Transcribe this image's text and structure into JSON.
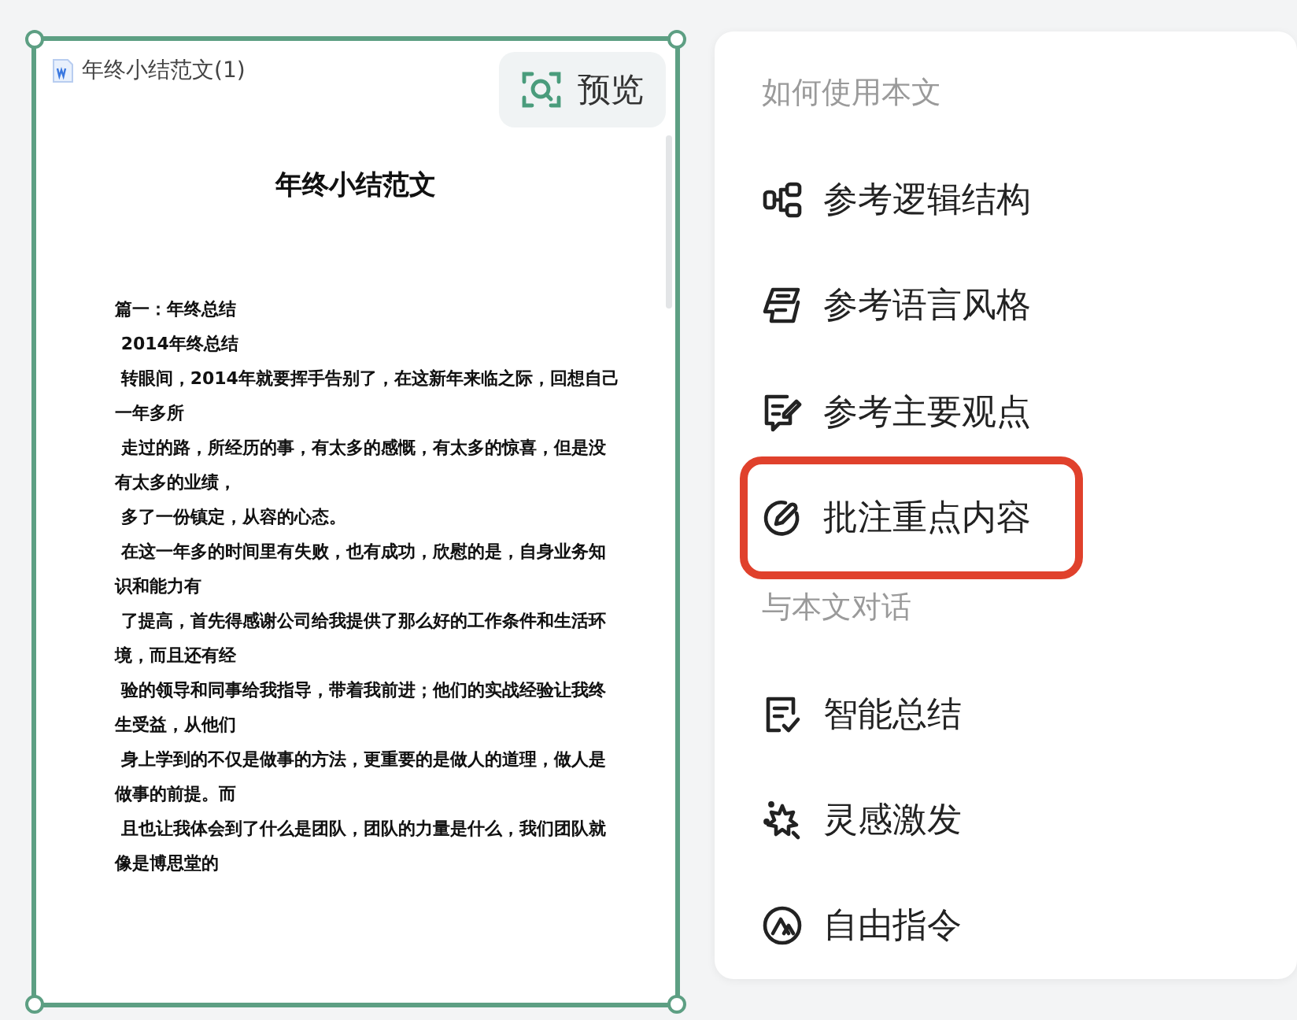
{
  "document": {
    "file_name": "年终小结范文(1)",
    "preview_button": "预览",
    "title": "年终小结范文",
    "lines": [
      "篇一：年终总结",
      " 2014年终总结",
      " 转眼间，2014年就要挥手告别了，在这新年来临之际，回想自己",
      "一年多所",
      " 走过的路，所经历的事，有太多的感慨，有太多的惊喜，但是没",
      "有太多的业绩，",
      " 多了一份镇定，从容的心态。",
      " 在这一年多的时间里有失败，也有成功，欣慰的是，自身业务知",
      "识和能力有",
      " 了提高，首先得感谢公司给我提供了那么好的工作条件和生活环",
      "境，而且还有经",
      " 验的领导和同事给我指导，带着我前进；他们的实战经验让我终",
      "生受益，从他们",
      " 身上学到的不仅是做事的方法，更重要的是做人的道理，做人是",
      "做事的前提。而",
      " 且也让我体会到了什么是团队，团队的力量是什么，我们团队就",
      "像是博思堂的"
    ]
  },
  "menu": {
    "sections": [
      {
        "title": "如何使用本文",
        "items": [
          {
            "label": "参考逻辑结构",
            "selected": false
          },
          {
            "label": "参考语言风格",
            "selected": false
          },
          {
            "label": "参考主要观点",
            "selected": false
          },
          {
            "label": "批注重点内容",
            "selected": true
          }
        ]
      },
      {
        "title": "与本文对话",
        "items": [
          {
            "label": "智能总结",
            "selected": false
          },
          {
            "label": "灵感激发",
            "selected": false
          },
          {
            "label": "自由指令",
            "selected": false
          }
        ]
      }
    ]
  }
}
